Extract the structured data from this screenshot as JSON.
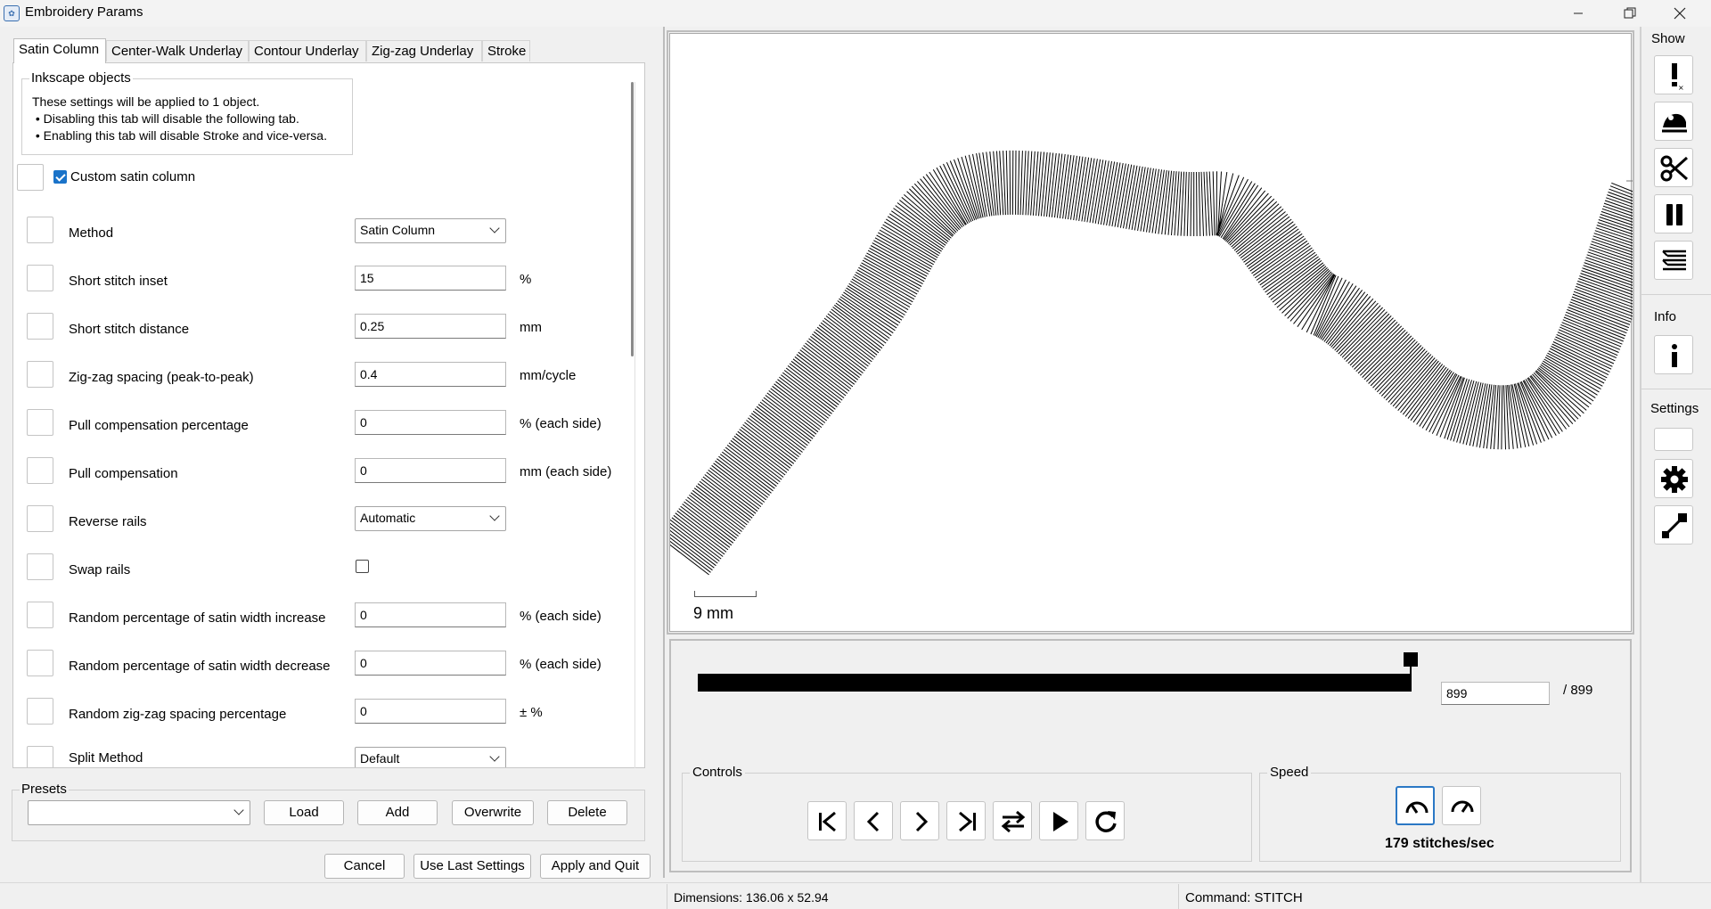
{
  "window": {
    "title": "Embroidery Params",
    "controls": [
      "minimize",
      "maximize",
      "close"
    ]
  },
  "tabs": [
    {
      "label": "Satin Column",
      "active": true
    },
    {
      "label": "Center-Walk Underlay",
      "active": false
    },
    {
      "label": "Contour Underlay",
      "active": false
    },
    {
      "label": "Zig-zag Underlay",
      "active": false
    },
    {
      "label": "Stroke",
      "active": false
    }
  ],
  "inkscape_objects": {
    "heading": "Inkscape objects",
    "lines": [
      "These settings will be applied to 1 object.",
      " • Disabling this tab will disable the following tab.",
      " • Enabling this tab will disable Stroke and vice-versa."
    ]
  },
  "custom_satin": {
    "label": "Custom satin column",
    "checked": true
  },
  "params": [
    {
      "label": "Method",
      "type": "select",
      "value": "Satin Column",
      "unit": ""
    },
    {
      "label": "Short stitch inset",
      "type": "text",
      "value": "15",
      "unit": "%"
    },
    {
      "label": "Short stitch distance",
      "type": "text",
      "value": "0.25",
      "unit": "mm"
    },
    {
      "label": "Zig-zag spacing (peak-to-peak)",
      "type": "text",
      "value": "0.4",
      "unit": "mm/cycle"
    },
    {
      "label": "Pull compensation percentage",
      "type": "text",
      "value": "0",
      "unit": "% (each side)"
    },
    {
      "label": "Pull compensation",
      "type": "text",
      "value": "0",
      "unit": "mm (each side)"
    },
    {
      "label": "Reverse rails",
      "type": "select",
      "value": "Automatic",
      "unit": ""
    },
    {
      "label": "Swap rails",
      "type": "checkbox",
      "value": "",
      "unit": ""
    },
    {
      "label": "Random percentage of satin width increase",
      "type": "text",
      "value": "0",
      "unit": "% (each side)"
    },
    {
      "label": "Random percentage of satin width decrease",
      "type": "text",
      "value": "0",
      "unit": "% (each side)"
    },
    {
      "label": "Random zig-zag spacing percentage",
      "type": "text",
      "value": "0",
      "unit": "± %"
    },
    {
      "label": "Split Method",
      "type": "select",
      "value": "Default",
      "unit": ""
    }
  ],
  "presets": {
    "heading": "Presets",
    "select_value": "",
    "buttons": [
      "Load",
      "Add",
      "Overwrite",
      "Delete"
    ]
  },
  "footer_buttons": [
    "Cancel",
    "Use Last Settings",
    "Apply and Quit"
  ],
  "canvas": {
    "scale_label": "9 mm"
  },
  "slider": {
    "current": "899",
    "total": "/ 899",
    "progress": 1.0
  },
  "controls": {
    "heading": "Controls",
    "buttons": [
      "skip-to-start-icon",
      "step-back-icon",
      "step-forward-icon",
      "skip-to-end-icon",
      "swap-direction-icon",
      "play-icon",
      "restart-icon"
    ]
  },
  "speed": {
    "heading": "Speed",
    "value_text": "179 stitches/sec"
  },
  "side_panel": {
    "show_label": "Show",
    "show_buttons": [
      "error-icon",
      "frog-icon",
      "scissors-icon",
      "pause-icon",
      "stitch-lines-icon"
    ],
    "info_label": "Info",
    "info_buttons": [
      "info-icon"
    ],
    "settings_label": "Settings",
    "settings_buttons": [
      "settings-blank",
      "gear-icon",
      "zoom-fit-icon"
    ]
  },
  "status": {
    "dimensions": "Dimensions: 136.06 x 52.94",
    "command": "Command: STITCH"
  },
  "colors": {
    "accent": "#1a73c9",
    "stitch": "#000000",
    "background": "#f0f0f0"
  }
}
